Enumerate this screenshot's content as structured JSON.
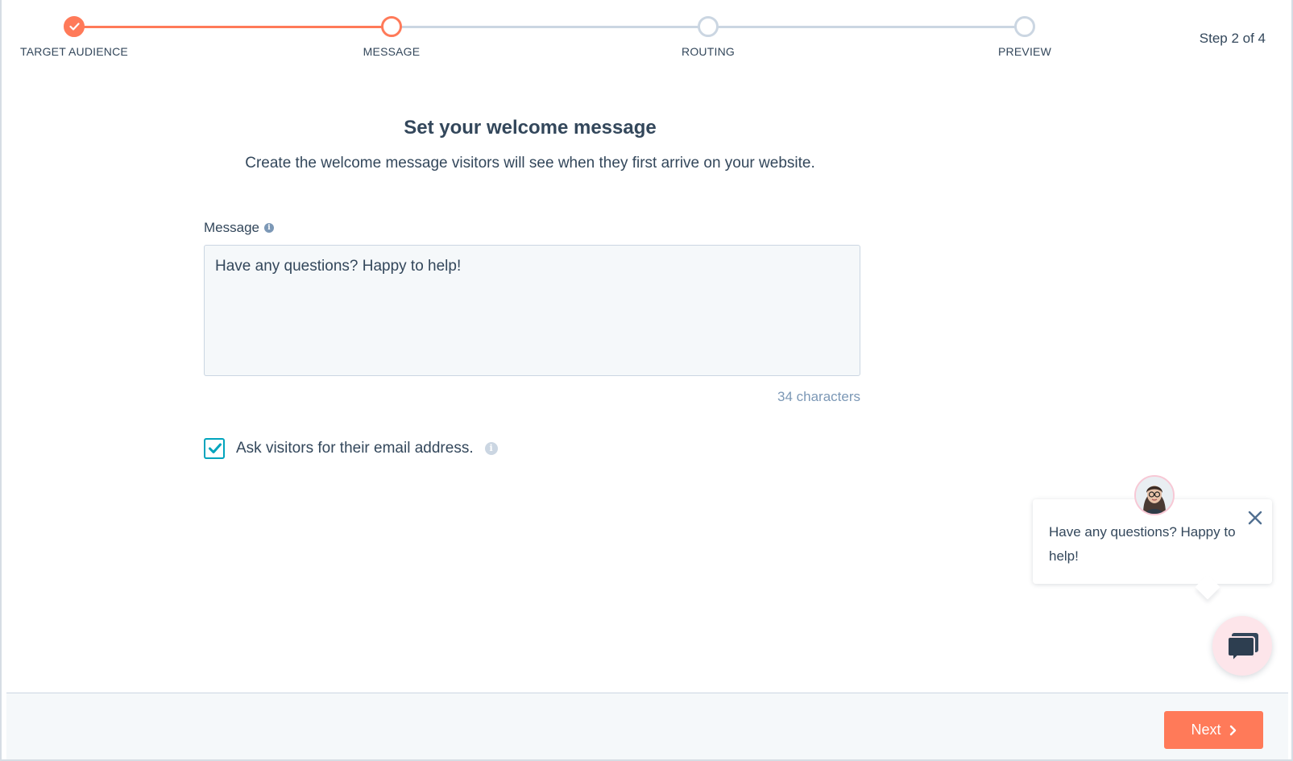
{
  "stepper": {
    "steps": [
      {
        "label": "TARGET AUDIENCE",
        "state": "done"
      },
      {
        "label": "MESSAGE",
        "state": "active"
      },
      {
        "label": "ROUTING",
        "state": "pending"
      },
      {
        "label": "PREVIEW",
        "state": "pending"
      }
    ],
    "step_count": "Step 2 of 4"
  },
  "main": {
    "title": "Set your welcome message",
    "subtitle": "Create the welcome message visitors will see when they first arrive on your website.",
    "message_label": "Message",
    "message_value": "Have any questions? Happy to help!",
    "char_count": "34 characters",
    "ask_email_label": "Ask visitors for their email address.",
    "ask_email_checked": true
  },
  "chat_preview": {
    "bubble_text": "Have any questions? Happy to help!",
    "icons": [
      "avatar",
      "close-icon",
      "chat-icon"
    ]
  },
  "footer": {
    "next_label": "Next"
  },
  "colors": {
    "accent": "#ff7a59",
    "checkbox": "#00a4bd",
    "text": "#33475b",
    "muted": "#7c98b6",
    "border": "#cbd6e2"
  }
}
